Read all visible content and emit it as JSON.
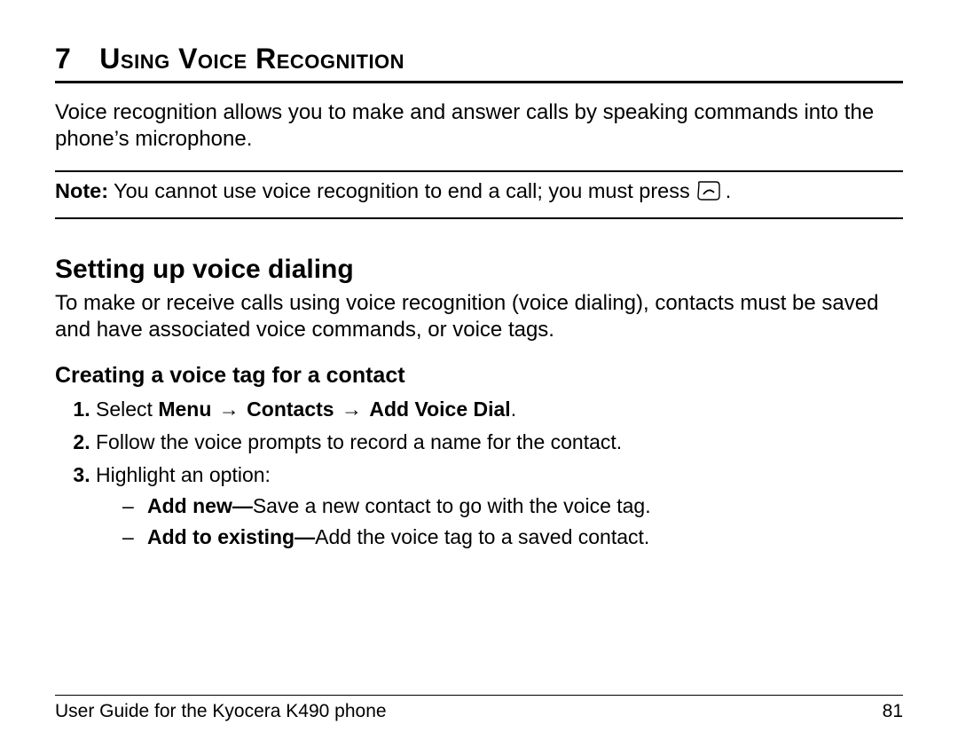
{
  "chapter": {
    "number": "7",
    "title": "Using Voice Recognition"
  },
  "intro": "Voice recognition allows you to make and answer calls by speaking commands into the phone’s microphone.",
  "note": {
    "label": "Note:",
    "text": "You cannot use voice recognition to end a call; you must press",
    "period": "."
  },
  "section_h2": "Setting up voice dialing",
  "section_intro": "To make or receive calls using voice recognition (voice dialing), contacts must be saved and have associated voice commands, or voice tags.",
  "section_h3": "Creating a voice tag for a contact",
  "steps": {
    "s1_prefix": "Select ",
    "s1_menu": "Menu",
    "s1_arrow": " → ",
    "s1_contacts": "Contacts",
    "s1_addvoice": "Add Voice Dial",
    "s1_suffix": ".",
    "s2": "Follow the voice prompts to record a name for the contact.",
    "s3": "Highlight an option:"
  },
  "options": {
    "a_bold": "Add new—",
    "a_text": "Save a new contact to go with the voice tag.",
    "b_bold": "Add to existing—",
    "b_text": "Add the voice tag to a saved contact."
  },
  "footer": {
    "guide": "User Guide for the Kyocera K490 phone",
    "page": "81"
  }
}
